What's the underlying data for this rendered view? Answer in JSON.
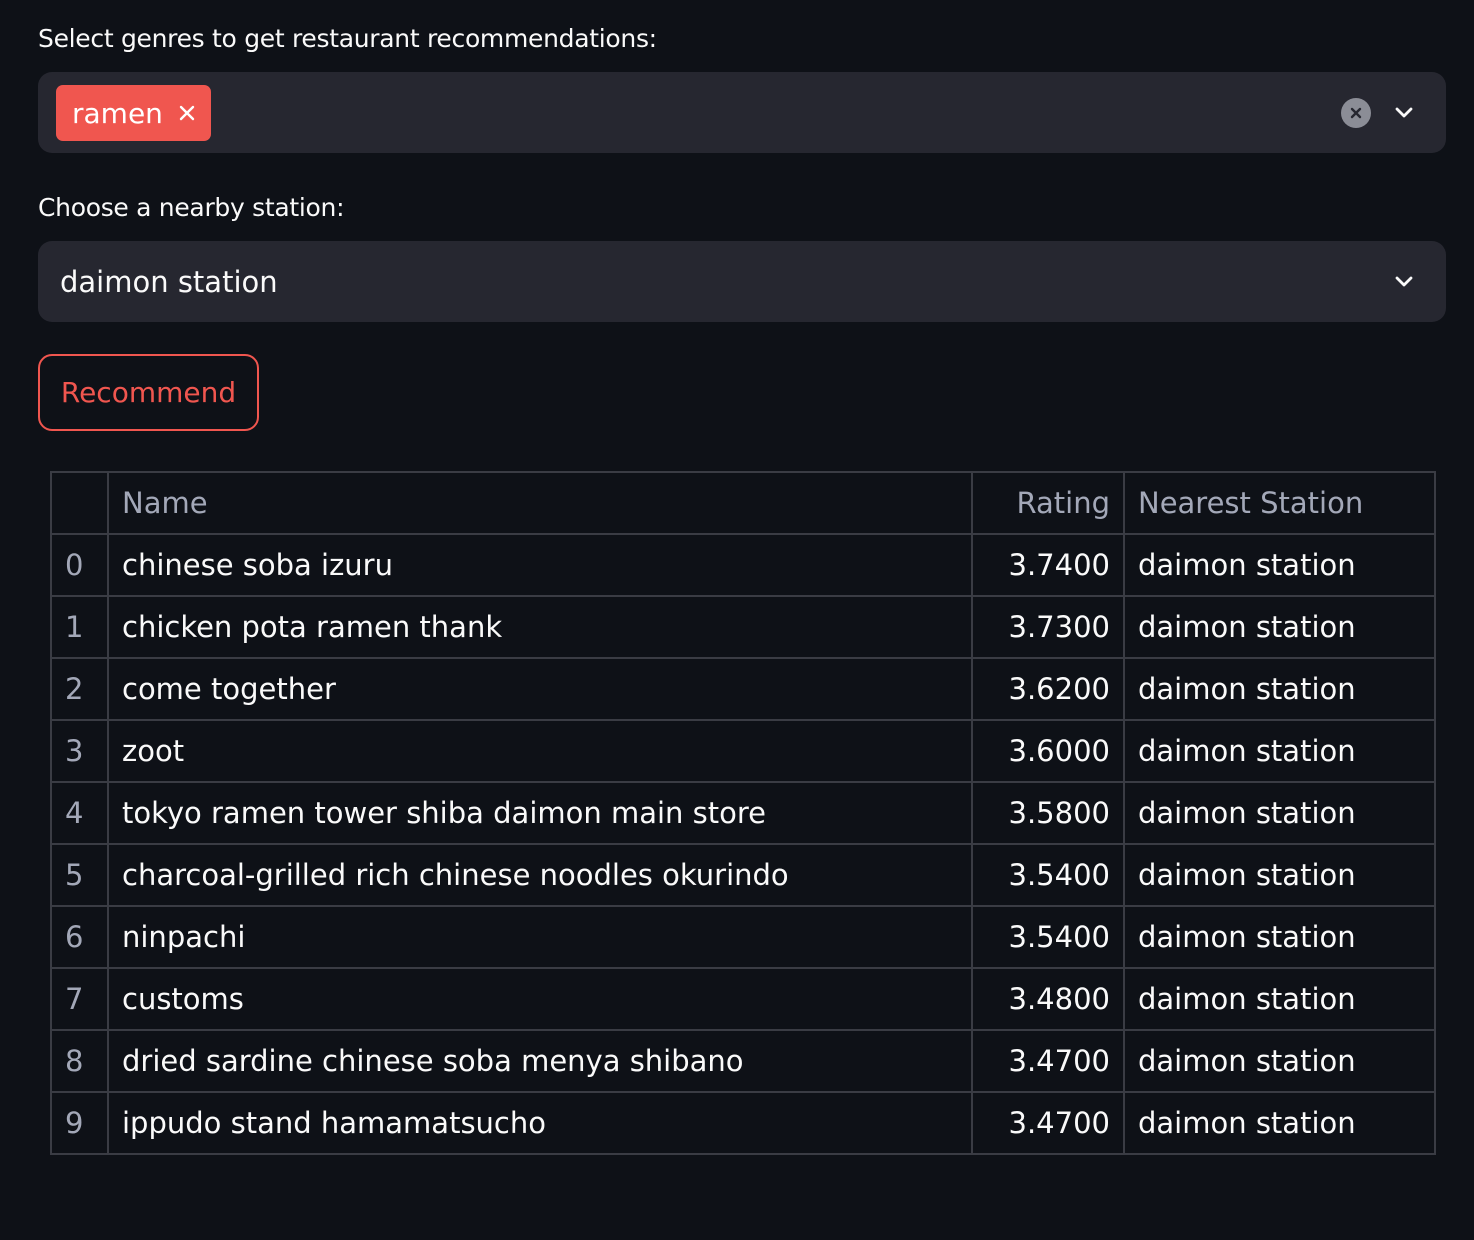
{
  "genre_select": {
    "label": "Select genres to get restaurant recommendations:",
    "selected_tags": [
      "ramen"
    ]
  },
  "station_select": {
    "label": "Choose a nearby station:",
    "value": "daimon station"
  },
  "recommend_button": {
    "label": "Recommend"
  },
  "table": {
    "columns": [
      "",
      "Name",
      "Rating",
      "Nearest Station"
    ],
    "rows": [
      {
        "index": "0",
        "name": "chinese soba izuru",
        "rating": "3.7400",
        "station": "daimon station"
      },
      {
        "index": "1",
        "name": "chicken pota ramen thank",
        "rating": "3.7300",
        "station": "daimon station"
      },
      {
        "index": "2",
        "name": "come together",
        "rating": "3.6200",
        "station": "daimon station"
      },
      {
        "index": "3",
        "name": "zoot",
        "rating": "3.6000",
        "station": "daimon station"
      },
      {
        "index": "4",
        "name": "tokyo ramen tower shiba daimon main store",
        "rating": "3.5800",
        "station": "daimon station"
      },
      {
        "index": "5",
        "name": "charcoal-grilled rich chinese noodles okurindo",
        "rating": "3.5400",
        "station": "daimon station"
      },
      {
        "index": "6",
        "name": "ninpachi",
        "rating": "3.5400",
        "station": "daimon station"
      },
      {
        "index": "7",
        "name": "customs",
        "rating": "3.4800",
        "station": "daimon station"
      },
      {
        "index": "8",
        "name": "dried sardine chinese soba menya shibano",
        "rating": "3.4700",
        "station": "daimon station"
      },
      {
        "index": "9",
        "name": "ippudo stand hamamatsucho",
        "rating": "3.4700",
        "station": "daimon station"
      }
    ]
  },
  "colors": {
    "background": "#0e1117",
    "input_background": "#262730",
    "accent": "#f0564f",
    "muted_text": "#a3a8b8",
    "table_border": "#3a3c44"
  },
  "icons": {
    "tag_remove": "close-icon",
    "clear_all": "clear-circle-icon",
    "dropdown": "chevron-down-icon"
  }
}
